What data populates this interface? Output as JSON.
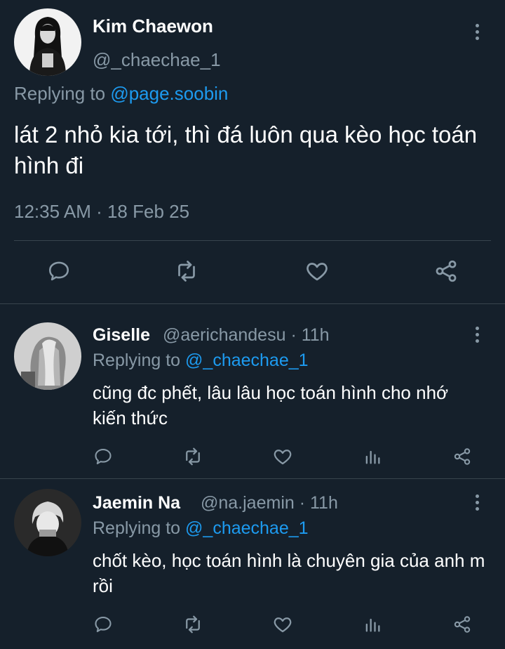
{
  "main": {
    "name": "Kim Chaewon",
    "handle": "@_chaechae_1",
    "replying_prefix": "Replying to ",
    "replying_to": "@page.soobin",
    "text": "lát 2 nhỏ kia tới, thì đá luôn qua kèo học toán hình đi",
    "timestamp": "12:35 AM · 18 Feb 25",
    "actions": [
      "reply-icon",
      "retweet-icon",
      "like-icon",
      "share-icon"
    ]
  },
  "replies": [
    {
      "name": "Giselle",
      "handle": "@aerichandesu",
      "time": "· 11h",
      "replying_prefix": "Replying to ",
      "replying_to": "@_chaechae_1",
      "text": "cũng đc phết, lâu lâu học toán hình cho nhớ kiến thức"
    },
    {
      "name": "Jaemin Na",
      "handle": "@na.jaemin",
      "time": "· 11h",
      "replying_prefix": "Replying to ",
      "replying_to": "@_chaechae_1",
      "text": "chốt kèo, học toán hình là chuyên gia của anh m rồi"
    }
  ],
  "reply_actions": [
    "reply-icon",
    "retweet-icon",
    "like-icon",
    "analytics-icon",
    "share-icon"
  ],
  "colors": {
    "background": "#15202b",
    "secondary_text": "#8899a6",
    "link": "#1d9bf0",
    "divider": "#38444d"
  }
}
